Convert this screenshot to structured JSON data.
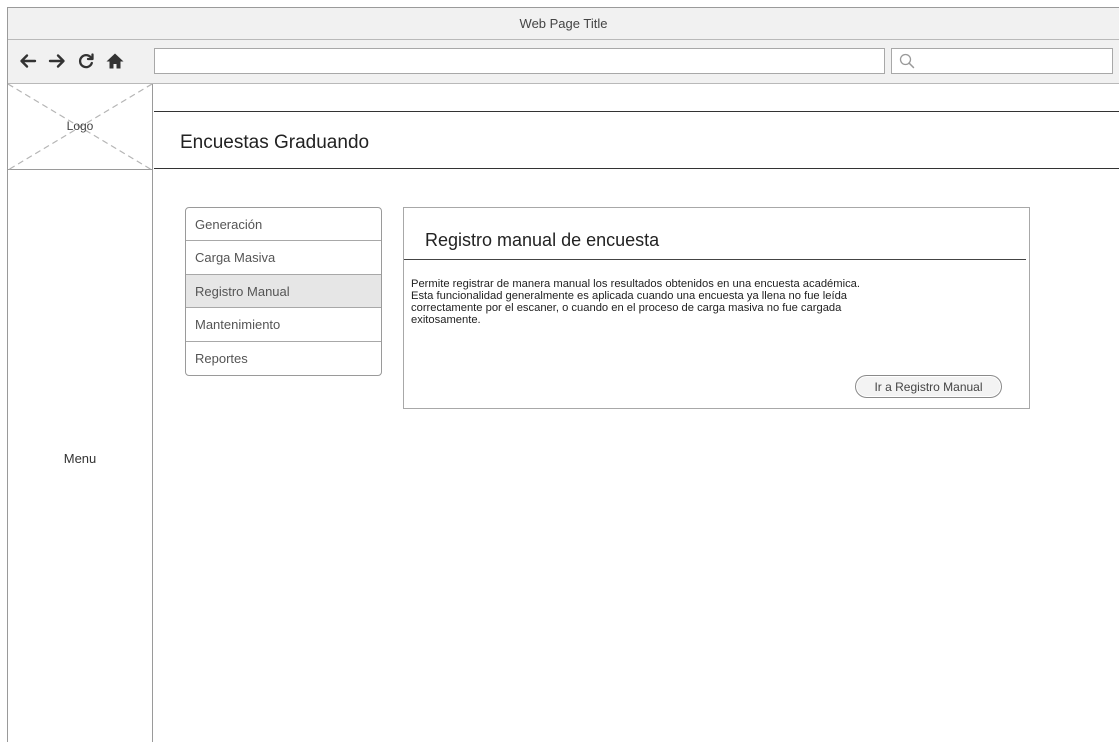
{
  "browser": {
    "title": "Web Page Title",
    "url": "",
    "search_placeholder": ""
  },
  "nav_icons": [
    "back-icon",
    "forward-icon",
    "reload-icon",
    "home-icon"
  ],
  "sidebar": {
    "logo_label": "Logo",
    "menu_label": "Menu"
  },
  "header": {
    "title": "Encuestas Graduando"
  },
  "sidenav": {
    "items": [
      {
        "label": "Generación",
        "active": false
      },
      {
        "label": "Carga Masiva",
        "active": false
      },
      {
        "label": "Registro Manual",
        "active": true
      },
      {
        "label": "Mantenimiento",
        "active": false
      },
      {
        "label": "Reportes",
        "active": false
      }
    ]
  },
  "card": {
    "title": "Registro manual de encuesta",
    "body_lines": [
      "Permite registrar de manera manual los resultados obtenidos en una encuesta académica.",
      "Esta funcionalidad generalmente es aplicada cuando una encuesta ya llena no fue leída",
      "correctamente por el escaner, o cuando en el proceso de carga masiva no fue cargada",
      "exitosamente."
    ],
    "button_label": "Ir a Registro Manual"
  }
}
